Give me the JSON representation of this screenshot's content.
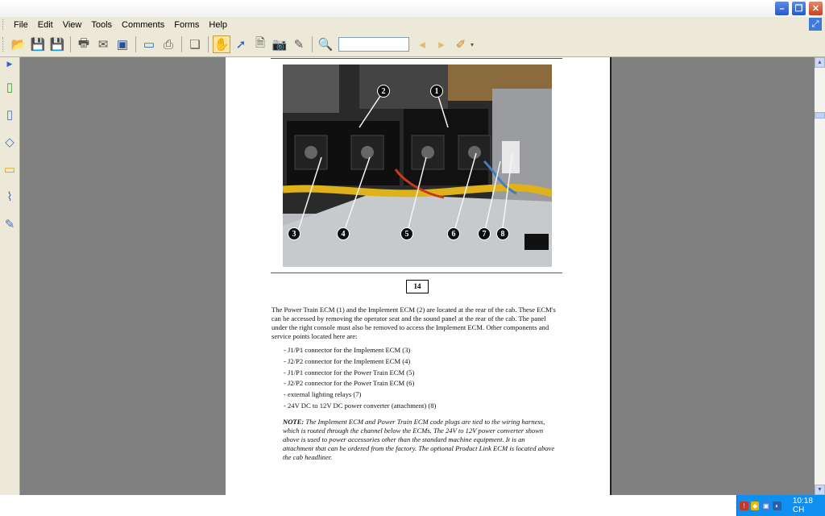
{
  "menu": [
    "File",
    "Edit",
    "View",
    "Tools",
    "Comments",
    "Forms",
    "Help"
  ],
  "toolbar_icons": [
    "open-icon",
    "save-icon",
    "save-copy-icon",
    "print-icon",
    "email-icon",
    "fax-icon",
    "screen-icon",
    "capture-icon",
    "pages-icon",
    "hand-tool-icon",
    "select-tool-icon",
    "text-select-icon",
    "snapshot-icon",
    "sign-icon",
    "find-icon",
    "find-previous-icon",
    "find-next-icon",
    "comment-icon"
  ],
  "find": {
    "value": ""
  },
  "document": {
    "page_number": "14",
    "callouts": [
      "1",
      "2",
      "3",
      "4",
      "5",
      "6",
      "7",
      "8"
    ],
    "paragraph": "The Power Train ECM (1) and the Implement ECM (2) are located at the rear of the cab.  These ECM's can be accessed by removing the operator seat and the sound panel at the rear of the cab. The panel under the right console must also be removed to access the Implement ECM.  Other components and service points located here are:",
    "bullets": [
      "- J1/P1 connector for the Implement ECM (3)",
      "- J2/P2 connector for the Implement ECM (4)",
      "- J1/P1 connector for the Power Train ECM (5)",
      "- J2/P2 connector for the Power Train ECM (6)",
      "- external lighting relays (7)",
      "- 24V DC to 12V DC power converter (attachment) (8)"
    ],
    "note_label": "NOTE:",
    "note_text": " The Implement ECM and Power Train ECM code plugs are tied to the wiring harness, which is routed through the channel below the ECMs.  The 24V to 12V power converter shown above is used to power accessories other than the standard machine equipment.  It is an attachment that can be ordered from the factory.  The optional Product Link ECM is located above the cab headliner."
  },
  "taskbar": {
    "clock": "10:18 CH"
  }
}
